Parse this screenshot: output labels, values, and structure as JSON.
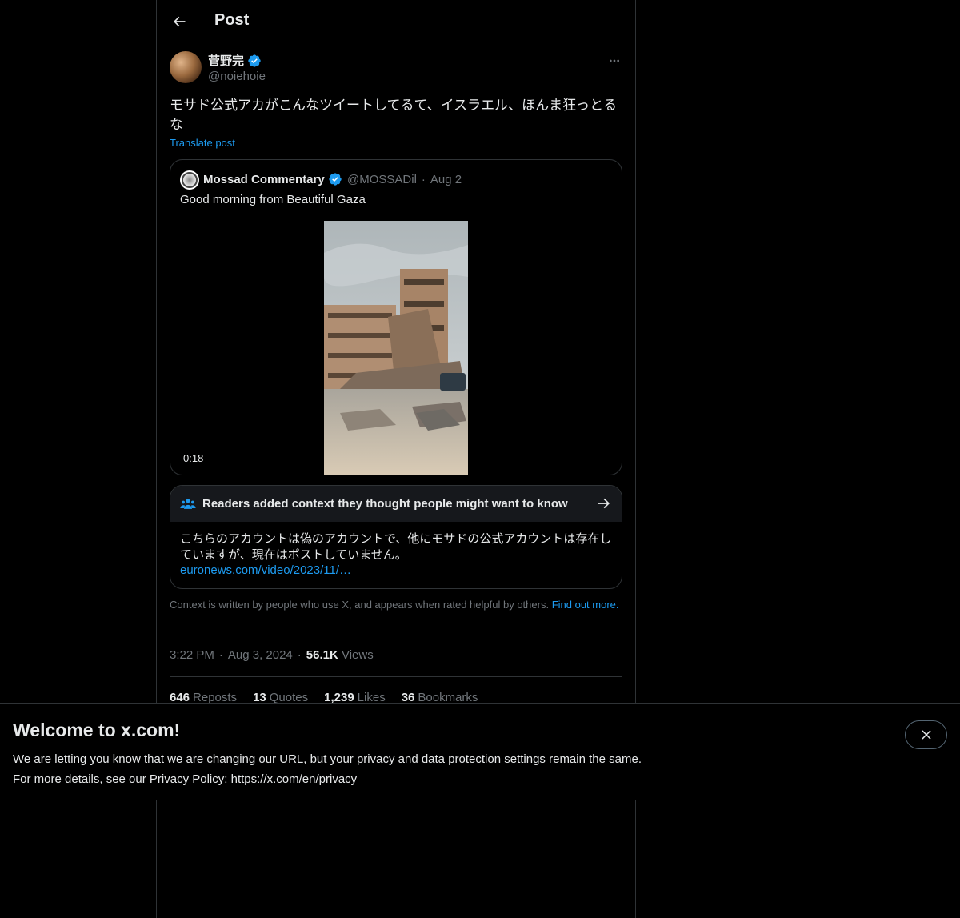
{
  "header": {
    "title": "Post"
  },
  "post": {
    "author_name": "菅野完",
    "author_handle": "@noiehoie",
    "text": "モサド公式アカがこんなツイートしてるて、イスラエル、ほんま狂っとるな",
    "translate_label": "Translate post",
    "time": "3:22 PM",
    "date": "Aug 3, 2024",
    "views_count": "56.1K",
    "views_label": "Views",
    "stats": {
      "reposts_count": "646",
      "reposts_label": "Reposts",
      "quotes_count": "13",
      "quotes_label": "Quotes",
      "likes_count": "1,239",
      "likes_label": "Likes",
      "bookmarks_count": "36",
      "bookmarks_label": "Bookmarks"
    }
  },
  "quoted_post": {
    "author_name": "Mossad Commentary",
    "author_handle": "@MOSSADil",
    "date": "Aug 2",
    "text": "Good morning from Beautiful Gaza",
    "video_duration": "0:18"
  },
  "community_note": {
    "title": "Readers added context they thought people might want to know",
    "body": "こちらのアカウントは偽のアカウントで、他にモサドの公式アカウントは存在していますが、現在はポストしていません。",
    "link": "euronews.com/video/2023/11/…",
    "footer_text": "Context is written by people who use X, and appears when rated helpful by others.",
    "footer_link": "Find out more."
  },
  "banner": {
    "title": "Welcome to x.com!",
    "line1": "We are letting you know that we are changing our URL, but your privacy and data protection settings remain the same.",
    "line2_prefix": "For more details, see our Privacy Policy:",
    "link": "https://x.com/en/privacy"
  },
  "icons": {
    "back": "arrow-left-icon",
    "verified": "verified-badge-icon",
    "more": "more-horizontal-icon",
    "people": "people-icon",
    "arrow_right": "arrow-right-icon",
    "close": "close-icon"
  },
  "colors": {
    "background": "#000000",
    "text": "#e7e9ea",
    "muted": "#71767b",
    "accent": "#1d9bf0",
    "border": "#2f3336"
  }
}
